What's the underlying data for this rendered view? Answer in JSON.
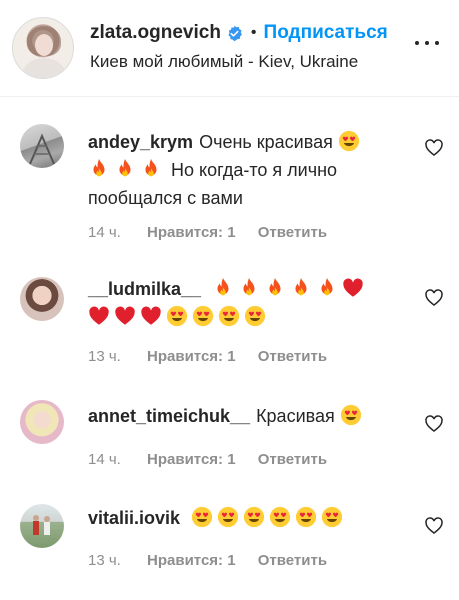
{
  "header": {
    "username": "zlata.ognevich",
    "follow_label": "Подписаться",
    "separator": "•",
    "location": "Киев мой любимый - Kiev, Ukraine"
  },
  "colors": {
    "accent": "#0095f6",
    "text": "#262626",
    "muted": "#8e8e8e"
  },
  "comments": [
    {
      "username": "andey_krym",
      "text1": "Очень красивая",
      "text2": "Но когда-то я лично",
      "text3": "пообщался с вами",
      "time": "14 ч.",
      "likes": "Нравится: 1",
      "reply": "Ответить"
    },
    {
      "username": "__ludmilka__",
      "time": "13 ч.",
      "likes": "Нравится: 1",
      "reply": "Ответить"
    },
    {
      "username": "annet_timeichuk__",
      "text1": "Красивая",
      "time": "14 ч.",
      "likes": "Нравится: 1",
      "reply": "Ответить"
    },
    {
      "username": "vitalii.iovik",
      "time": "13 ч.",
      "likes": "Нравится: 1",
      "reply": "Ответить"
    }
  ],
  "icons": [
    "verified-badge-icon",
    "more-options-icon",
    "heart-outline-icon",
    "heart-eyes-emoji",
    "fire-emoji",
    "red-heart-emoji"
  ]
}
